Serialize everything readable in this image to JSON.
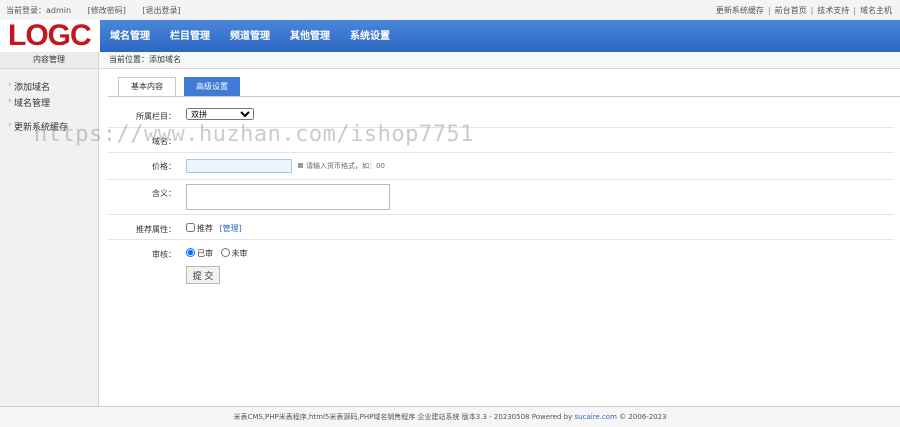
{
  "topbar": {
    "login_prefix": "当前登录：",
    "username": "admin",
    "change_password": "[修改密码]",
    "logout": "[退出登录]",
    "links": [
      "更新系统缓存",
      "前台首页",
      "技术支持",
      "域名主机"
    ]
  },
  "logo_text": "LOGC",
  "nav": [
    "域名管理",
    "栏目管理",
    "频道管理",
    "其他管理",
    "系统设置"
  ],
  "sidebar": {
    "title": "内容管理",
    "items": [
      "添加域名",
      "域名管理",
      "更新系统缓存"
    ]
  },
  "breadcrumb": {
    "label": "当前位置：",
    "current": "添加域名"
  },
  "tabs": [
    "基本内容",
    "高级设置"
  ],
  "form": {
    "category_label": "所属栏目：",
    "category_value": "双拼",
    "domain_label": "域名：",
    "price_label": "价格：",
    "price_hint": "请输入货币格式，如：00",
    "meaning_label": "含义：",
    "recommend_label": "推荐属性：",
    "recommend_option": "推荐",
    "recommend_manage": "[管理]",
    "audit_label": "审核：",
    "audit_options": [
      "已审",
      "未审"
    ],
    "audit_selected": "已审",
    "submit_label": "提 交"
  },
  "footer": {
    "text": "米表CMS,PHP米表程序,html5米表源码,PHP域名销售程序 企业建站系统 版本3.3 - 20230508 Powered by",
    "brand": "sucaire.com",
    "copyright": "© 2006-2023"
  },
  "watermark": "https://www.huzhan.com/ishop7751",
  "colors": {
    "nav_bg": "#2c68c2",
    "logo_red": "#c4161c",
    "tab_inactive": "#3f7bd2"
  }
}
